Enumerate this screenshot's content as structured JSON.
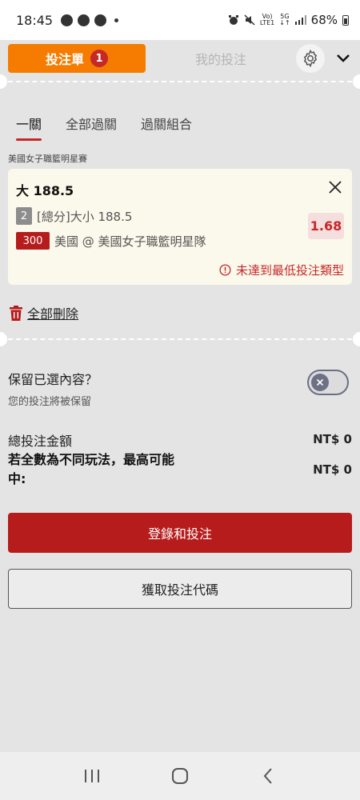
{
  "status_bar": {
    "time": "18:45",
    "network_top": "Vo)",
    "network_bottom": "LTE1",
    "gen_top": "5G",
    "gen_bottom": "↓↑",
    "battery": "68%"
  },
  "header": {
    "betslip_label": "投注單",
    "betslip_count": "1",
    "mybets_label": "我的投注"
  },
  "tabs": [
    "一關",
    "全部過關",
    "過關組合"
  ],
  "bet": {
    "league": "美國女子職籃明星賽",
    "selection": "大 188.5",
    "number": "2",
    "market": "[總分]大小 188.5",
    "code": "300",
    "match": "美國 @ 美國女子職籃明星隊",
    "odds": "1.68",
    "warning": "未達到最低投注類型"
  },
  "delete_all_label": "全部刪除",
  "keep": {
    "title": "保留已選內容？",
    "subtitle": "您的投注將被保留"
  },
  "totals": {
    "total_label": "總投注金額",
    "total_value": "NT$ 0",
    "max_win_label": "若全數為不同玩法，最高可能中:",
    "max_win_value": "NT$ 0"
  },
  "buttons": {
    "login_bet": "登錄和投注",
    "get_code": "獲取投注代碼"
  },
  "colors": {
    "accent_orange": "#f57c00",
    "brand_red": "#b71c1c",
    "card_bg": "#fbf9ec"
  }
}
